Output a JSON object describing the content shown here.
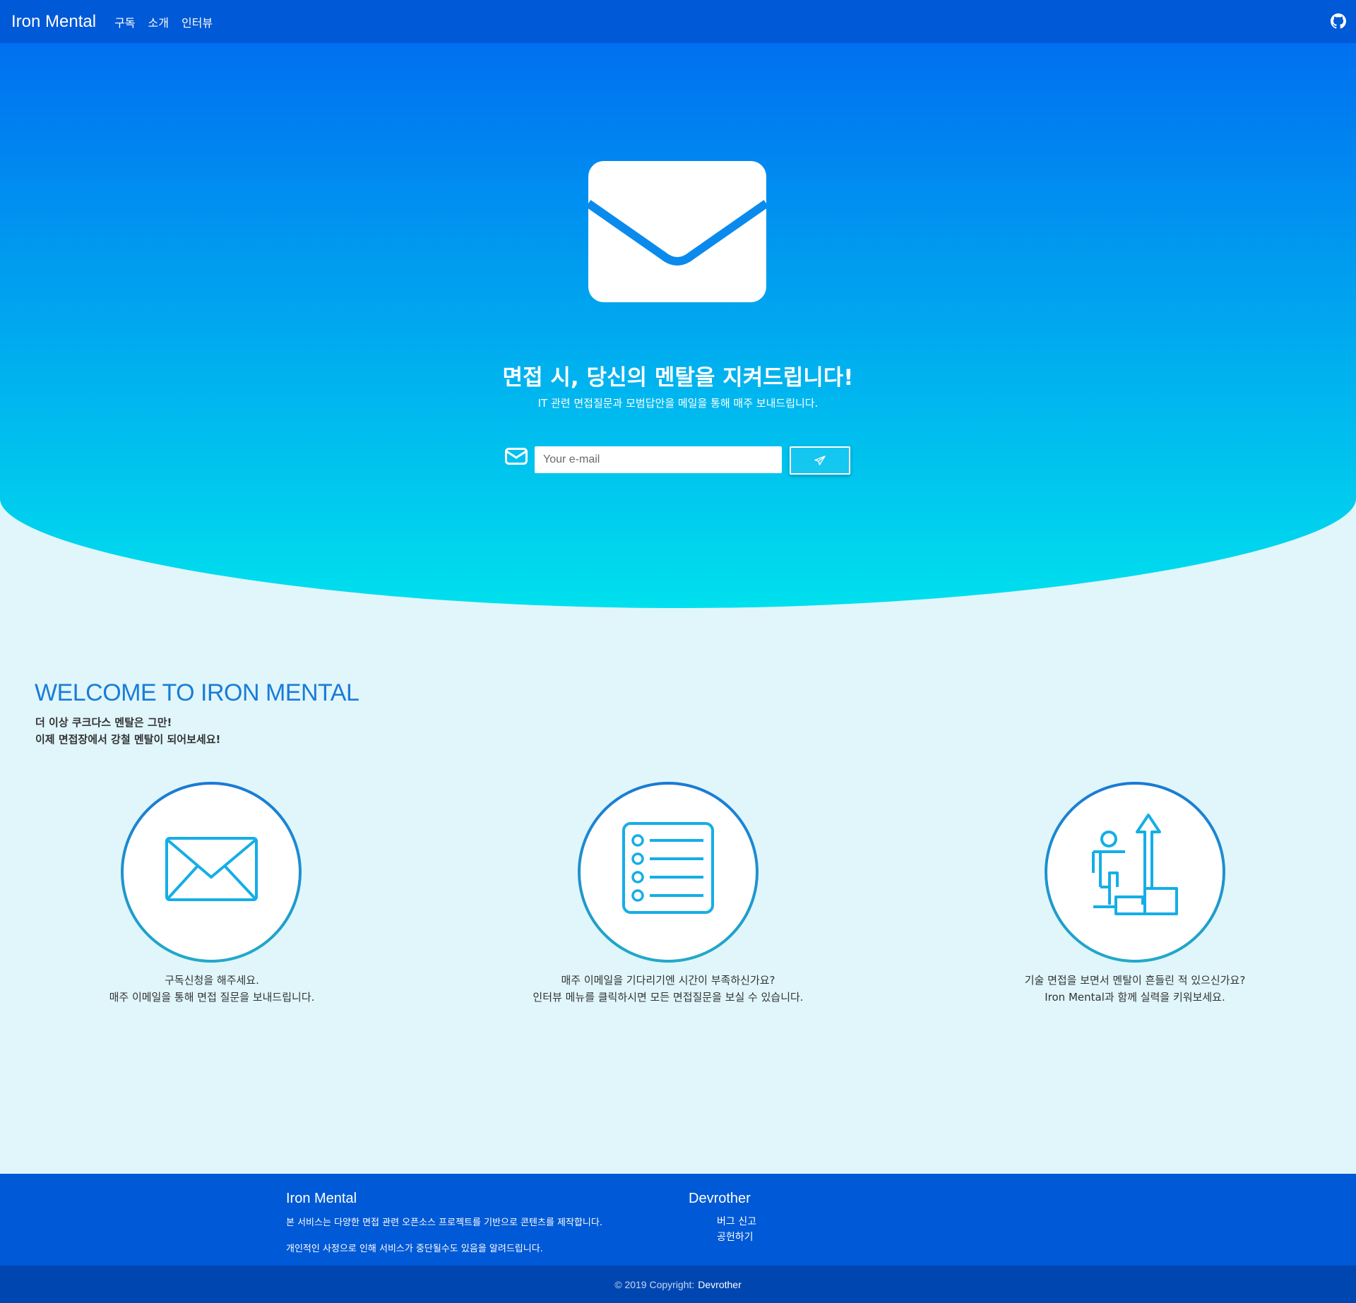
{
  "nav": {
    "brand": "Iron Mental",
    "links": [
      "구독",
      "소개",
      "인터뷰"
    ],
    "github_icon": "github-icon"
  },
  "hero": {
    "icon": "envelope-icon",
    "title": "면접 시, 당신의 멘탈을 지켜드립니다!",
    "subtitle": "IT 관련 면접질문과 모범답안을 메일을 통해 매주 보내드립니다.",
    "input_placeholder": "Your e-mail",
    "input_value": "",
    "send_icon": "paper-plane-icon",
    "colors": {
      "gradient_top": "#0070f0",
      "gradient_bottom": "#00e0ee"
    }
  },
  "welcome": {
    "title": "WELCOME TO IRON MENTAL",
    "lines": [
      "더 이상 쿠크다스 멘탈은 그만!",
      "이제 면접장에서 강철 멘탈이 되어보세요!"
    ]
  },
  "features": [
    {
      "icon": "envelope-outline-icon",
      "lines": [
        "구독신청을 해주세요.",
        "매주 이메일을 통해 면접 질문을 보내드립니다."
      ]
    },
    {
      "icon": "list-icon",
      "lines": [
        "매주 이메일을 기다리기엔 시간이 부족하신가요?",
        "인터뷰 메뉴를 클릭하시면 모든 면접질문을 보실 수 있습니다."
      ]
    },
    {
      "icon": "climbing-stairs-icon",
      "lines": [
        "기술 면접을 보면서 멘탈이 흔들린 적 있으신가요?",
        "Iron Mental과 함께 실력을 키워보세요."
      ]
    }
  ],
  "footer": {
    "left_title": "Iron Mental",
    "left_text_1": "본 서비스는 다양한 면접 관련 오픈소스 프로젝트를 기반으로 콘텐츠를 제작합니다.",
    "left_text_2": "개인적인 사정으로 인해 서비스가 중단될수도 있음을 알려드립니다.",
    "right_title": "Devrother",
    "links": [
      "버그 신고",
      "공헌하기"
    ],
    "copyright": "© 2019 Copyright:",
    "copyright_owner": "Devrother"
  }
}
